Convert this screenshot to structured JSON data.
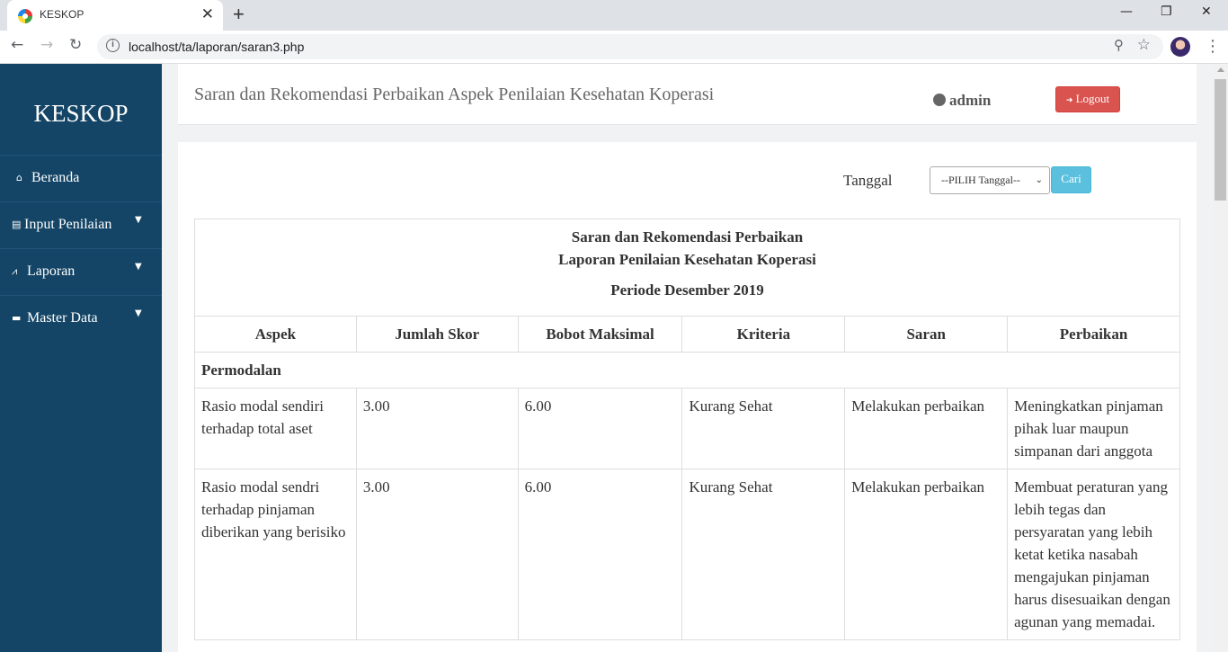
{
  "browser": {
    "tab_title": "KESKOP",
    "tab_close": "✕",
    "new_tab": "+",
    "url": "localhost/ta/laporan/saran3.php",
    "window_controls": [
      "—",
      "❐",
      "✕"
    ]
  },
  "sidebar": {
    "brand": "KESKOP",
    "items": [
      {
        "label": "Beranda",
        "icon": "home-icon",
        "has_caret": false
      },
      {
        "label": "Input Penilaian",
        "icon": "file-icon",
        "has_caret": true
      },
      {
        "label": "Laporan",
        "icon": "chart-icon",
        "has_caret": true
      },
      {
        "label": "Master Data",
        "icon": "folder-icon",
        "has_caret": true
      }
    ]
  },
  "header": {
    "title": "Saran dan Rekomendasi Perbaikan Aspek Penilaian Kesehatan Koperasi",
    "user": "admin",
    "logout_label": "Logout"
  },
  "filter": {
    "label": "Tanggal",
    "select_value": "--PILIH Tanggal--",
    "button_label": "Cari"
  },
  "report": {
    "title_line1": "Saran dan Rekomendasi Perbaikan",
    "title_line2": "Laporan Penilaian Kesehatan Koperasi",
    "period": "Periode Desember 2019",
    "columns": [
      "Aspek",
      "Jumlah Skor",
      "Bobot Maksimal",
      "Kriteria",
      "Saran",
      "Perbaikan"
    ],
    "section": "Permodalan",
    "rows": [
      {
        "aspek": "Rasio modal sendiri terhadap total aset",
        "jumlah_skor": "3.00",
        "bobot_maksimal": "6.00",
        "kriteria": "Kurang Sehat",
        "saran": "Melakukan perbaikan",
        "perbaikan": "Meningkatkan pinjaman pihak luar maupun simpanan dari anggota"
      },
      {
        "aspek": "Rasio modal sendri terhadap pinjaman diberikan yang berisiko",
        "jumlah_skor": "3.00",
        "bobot_maksimal": "6.00",
        "kriteria": "Kurang Sehat",
        "saran": "Melakukan perbaikan",
        "perbaikan": "Membuat peraturan yang lebih tegas dan persyaratan yang lebih ketat ketika nasabah mengajukan pinjaman harus disesuaikan dengan agunan yang memadai."
      }
    ]
  },
  "colors": {
    "sidebar": "#144566",
    "logout": "#d9534f",
    "search_button": "#5bc0de"
  }
}
